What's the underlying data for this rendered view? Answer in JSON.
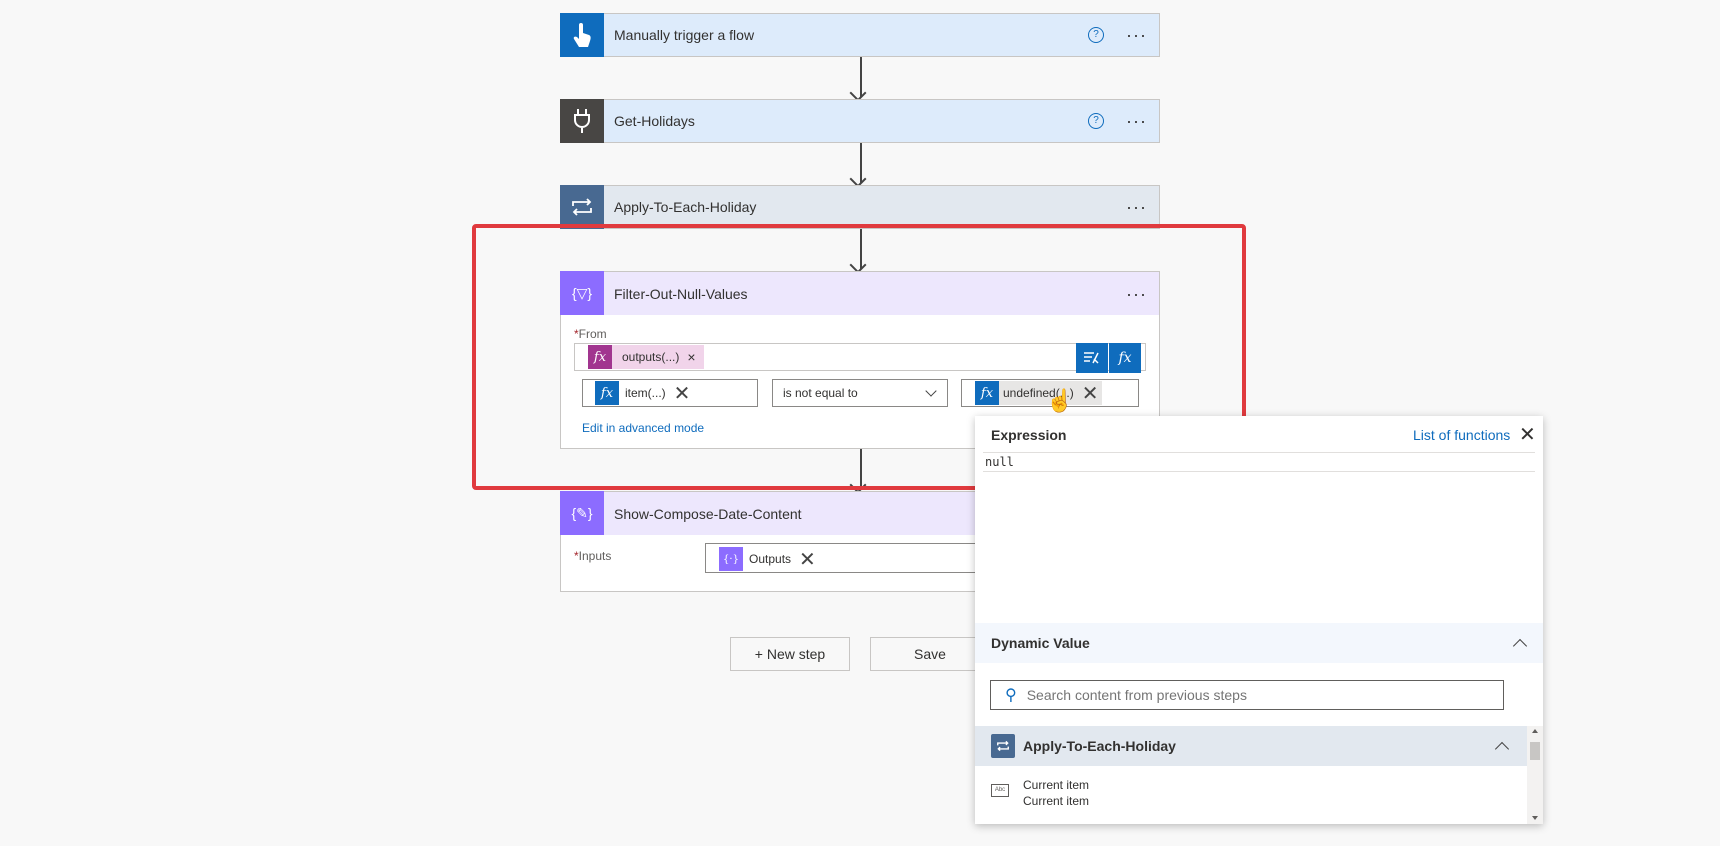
{
  "steps": {
    "trigger": {
      "title": "Manually trigger a flow",
      "help": "?",
      "more": "···"
    },
    "holidays": {
      "title": "Get-Holidays",
      "help": "?",
      "more": "···"
    },
    "apply": {
      "title": "Apply-To-Each-Holiday",
      "more": "···"
    },
    "filter": {
      "title": "Filter-Out-Null-Values",
      "more": "···",
      "from_label": "From",
      "required_mark": "*",
      "from_token": "outputs(...)",
      "from_token_remove": "×",
      "left_token": "item(...)",
      "operator": "is not equal to",
      "right_token": "undefined(...)",
      "advanced_link": "Edit in advanced mode"
    },
    "compose": {
      "title": "Show-Compose-Date-Content",
      "inputs_label": "Inputs",
      "required_mark": "*",
      "token": "Outputs"
    }
  },
  "actions": {
    "new_step": "+ New step",
    "save": "Save"
  },
  "expression_panel": {
    "title": "Expression",
    "list_link": "List of functions",
    "expression_value": "null",
    "dynamic_title": "Dynamic Value",
    "search_placeholder": "Search content from previous steps",
    "group_title": "Apply-To-Each-Holiday",
    "item_title": "Current item",
    "item_subtitle": "Current item"
  },
  "colors": {
    "trigger_icon": "#0f6cbd",
    "connector_icon": "#484644",
    "loop_icon": "#486991",
    "data_icon": "#8c6cff",
    "token_func": "#a1358f",
    "token_blue": "#0f6cbd",
    "highlight": "#e03a3e"
  }
}
